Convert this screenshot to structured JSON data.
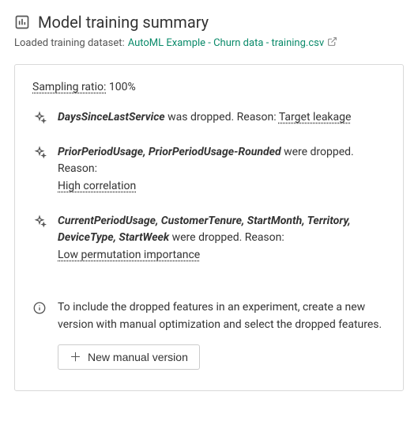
{
  "header": {
    "title": "Model training summary",
    "dataset_label": "Loaded training dataset:",
    "dataset_name": "AutoML Example - Churn data - training.csv"
  },
  "card": {
    "sampling_label": "Sampling ratio:",
    "sampling_value": "100%",
    "drops": [
      {
        "features": "DaysSinceLastService",
        "suffix": " was dropped. Reason: ",
        "reason": "Target leakage",
        "reason_inline": true
      },
      {
        "features": "PriorPeriodUsage, PriorPeriodUsage-Rounded",
        "suffix": " were dropped. Reason:",
        "reason": "High correlation",
        "reason_inline": false
      },
      {
        "features": "CurrentPeriodUsage, CustomerTenure, StartMonth, Territory, DeviceType, StartWeek",
        "suffix": " were dropped. Reason:",
        "reason": "Low permutation importance",
        "reason_inline": false
      }
    ],
    "info_text": "To include the dropped features in an experiment, create a new version with manual optimization and select the dropped features.",
    "button_label": "New manual version"
  }
}
